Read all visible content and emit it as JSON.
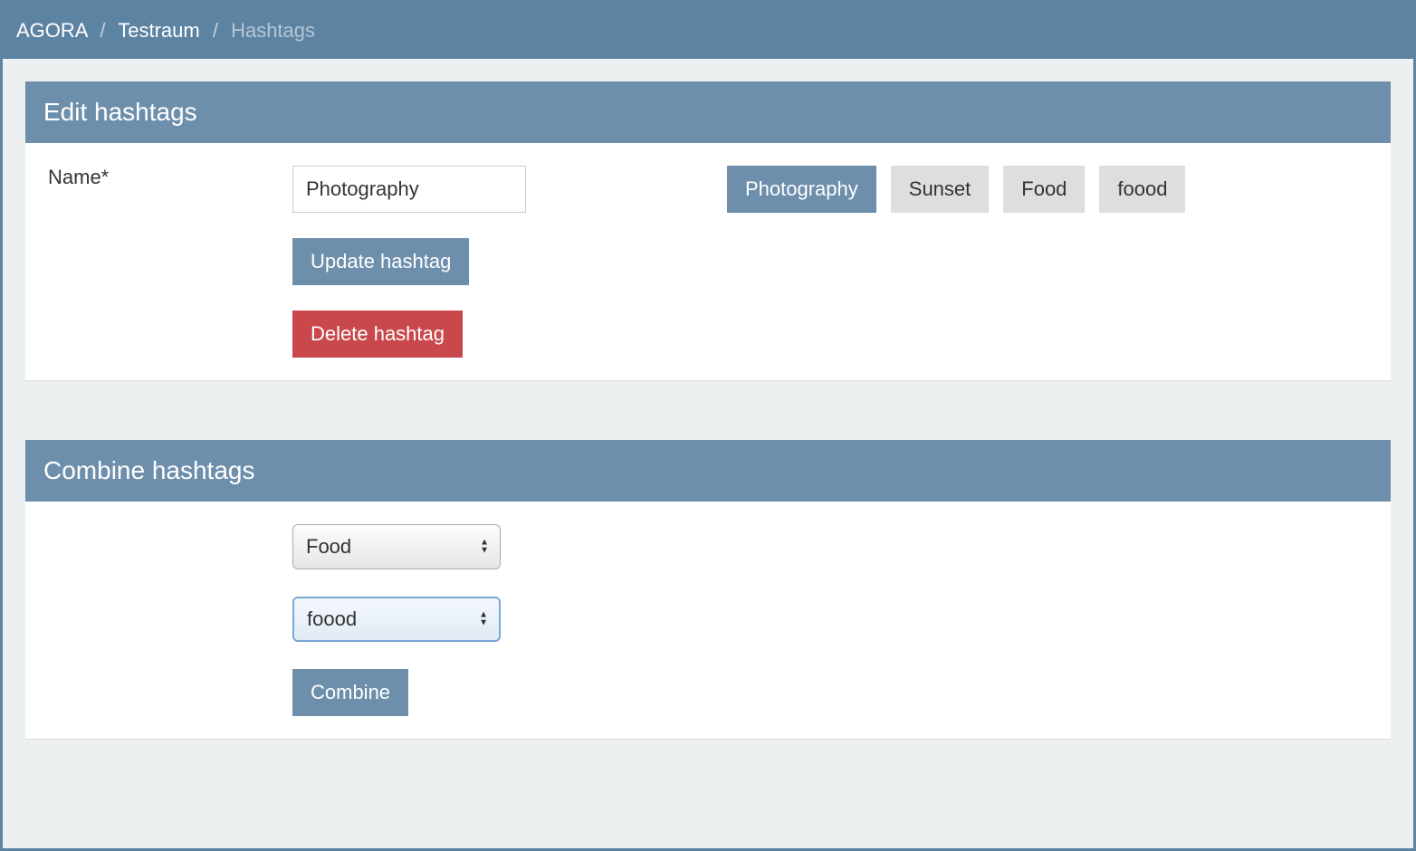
{
  "breadcrumb": {
    "items": [
      "AGORA",
      "Testraum"
    ],
    "current": "Hashtags"
  },
  "editPanel": {
    "title": "Edit hashtags",
    "nameLabel": "Name*",
    "nameValue": "Photography",
    "updateLabel": "Update hashtag",
    "deleteLabel": "Delete hashtag",
    "tags": [
      {
        "label": "Photography",
        "active": true
      },
      {
        "label": "Sunset",
        "active": false
      },
      {
        "label": "Food",
        "active": false
      },
      {
        "label": "foood",
        "active": false
      }
    ]
  },
  "combinePanel": {
    "title": "Combine hashtags",
    "select1": "Food",
    "select2": "foood",
    "combineLabel": "Combine"
  }
}
